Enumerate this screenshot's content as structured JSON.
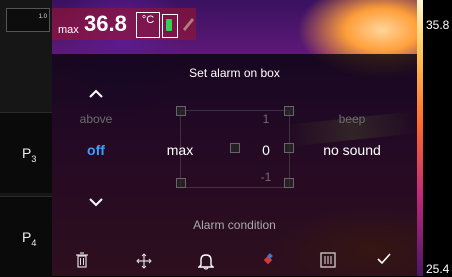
{
  "left_panel": {
    "zoom": "1.0",
    "presets": [
      {
        "label": "P",
        "sub": "3"
      },
      {
        "label": "P",
        "sub": "4"
      }
    ]
  },
  "readout": {
    "label": "max",
    "value": "36.8",
    "unit": "°C"
  },
  "scale": {
    "max": "35.8",
    "min": "25.4"
  },
  "dialog": {
    "title": "Set alarm on box",
    "mode_column": {
      "up": "⌃",
      "prev": "above",
      "current": "off",
      "down": "⌄"
    },
    "measure_column": {
      "current": "max"
    },
    "value_column": {
      "prev": "1",
      "current": "0",
      "next": "-1"
    },
    "sound_column": {
      "prev": "beep",
      "current": "no sound"
    },
    "condition_label": "Alarm condition"
  },
  "toolbar": {
    "delete": "🗑",
    "move": "✥",
    "alarm": "🔔",
    "color": "◆",
    "grid": "▦",
    "confirm": "✓"
  },
  "colors": {
    "selected": "#3aa0ff",
    "battery": "#2fd34f"
  }
}
